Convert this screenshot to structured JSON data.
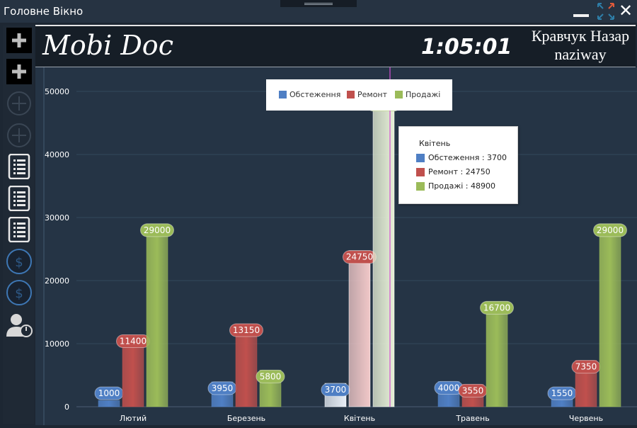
{
  "window": {
    "title": "Головне Вікно"
  },
  "header": {
    "app_title": "Mobi Doc",
    "clock": "1:05:01",
    "user_line1": "Кравчук Назар",
    "user_line2": "naziway"
  },
  "legend": {
    "items": [
      "Обстеження",
      "Ремонт",
      "Продажі"
    ]
  },
  "tooltip": {
    "title": "Квітень",
    "rows": [
      "Обстеження : 3700",
      "Ремонт : 24750",
      "Продажі : 48900"
    ]
  },
  "colors": {
    "blue": "#4f7fc4",
    "red": "#c0504d",
    "green": "#9bbb59",
    "background": "#253445",
    "crosshair": "#d24fd2"
  },
  "icons": [
    "plus-icon",
    "plus-icon",
    "add-circle-icon",
    "add-circle-icon",
    "list-icon",
    "list-icon",
    "list-icon",
    "dollar-icon",
    "dollar-icon",
    "user-power-icon"
  ],
  "chart_data": {
    "type": "bar",
    "categories": [
      "Лютий",
      "Березень",
      "Квітень",
      "Травень",
      "Червень"
    ],
    "series": [
      {
        "name": "Обстеження",
        "values": [
          1000,
          3950,
          3700,
          4000,
          1550
        ]
      },
      {
        "name": "Ремонт",
        "values": [
          11400,
          13150,
          24750,
          3550,
          7350
        ]
      },
      {
        "name": "Продажі",
        "values": [
          29000,
          5800,
          48900,
          16700,
          29000
        ]
      }
    ],
    "yticks": [
      "0",
      "10000",
      "20000",
      "30000",
      "40000",
      "50000"
    ],
    "ylim": [
      0,
      52000
    ],
    "highlighted_category": "Квітень",
    "grid": true,
    "legend_position": "top-center"
  }
}
